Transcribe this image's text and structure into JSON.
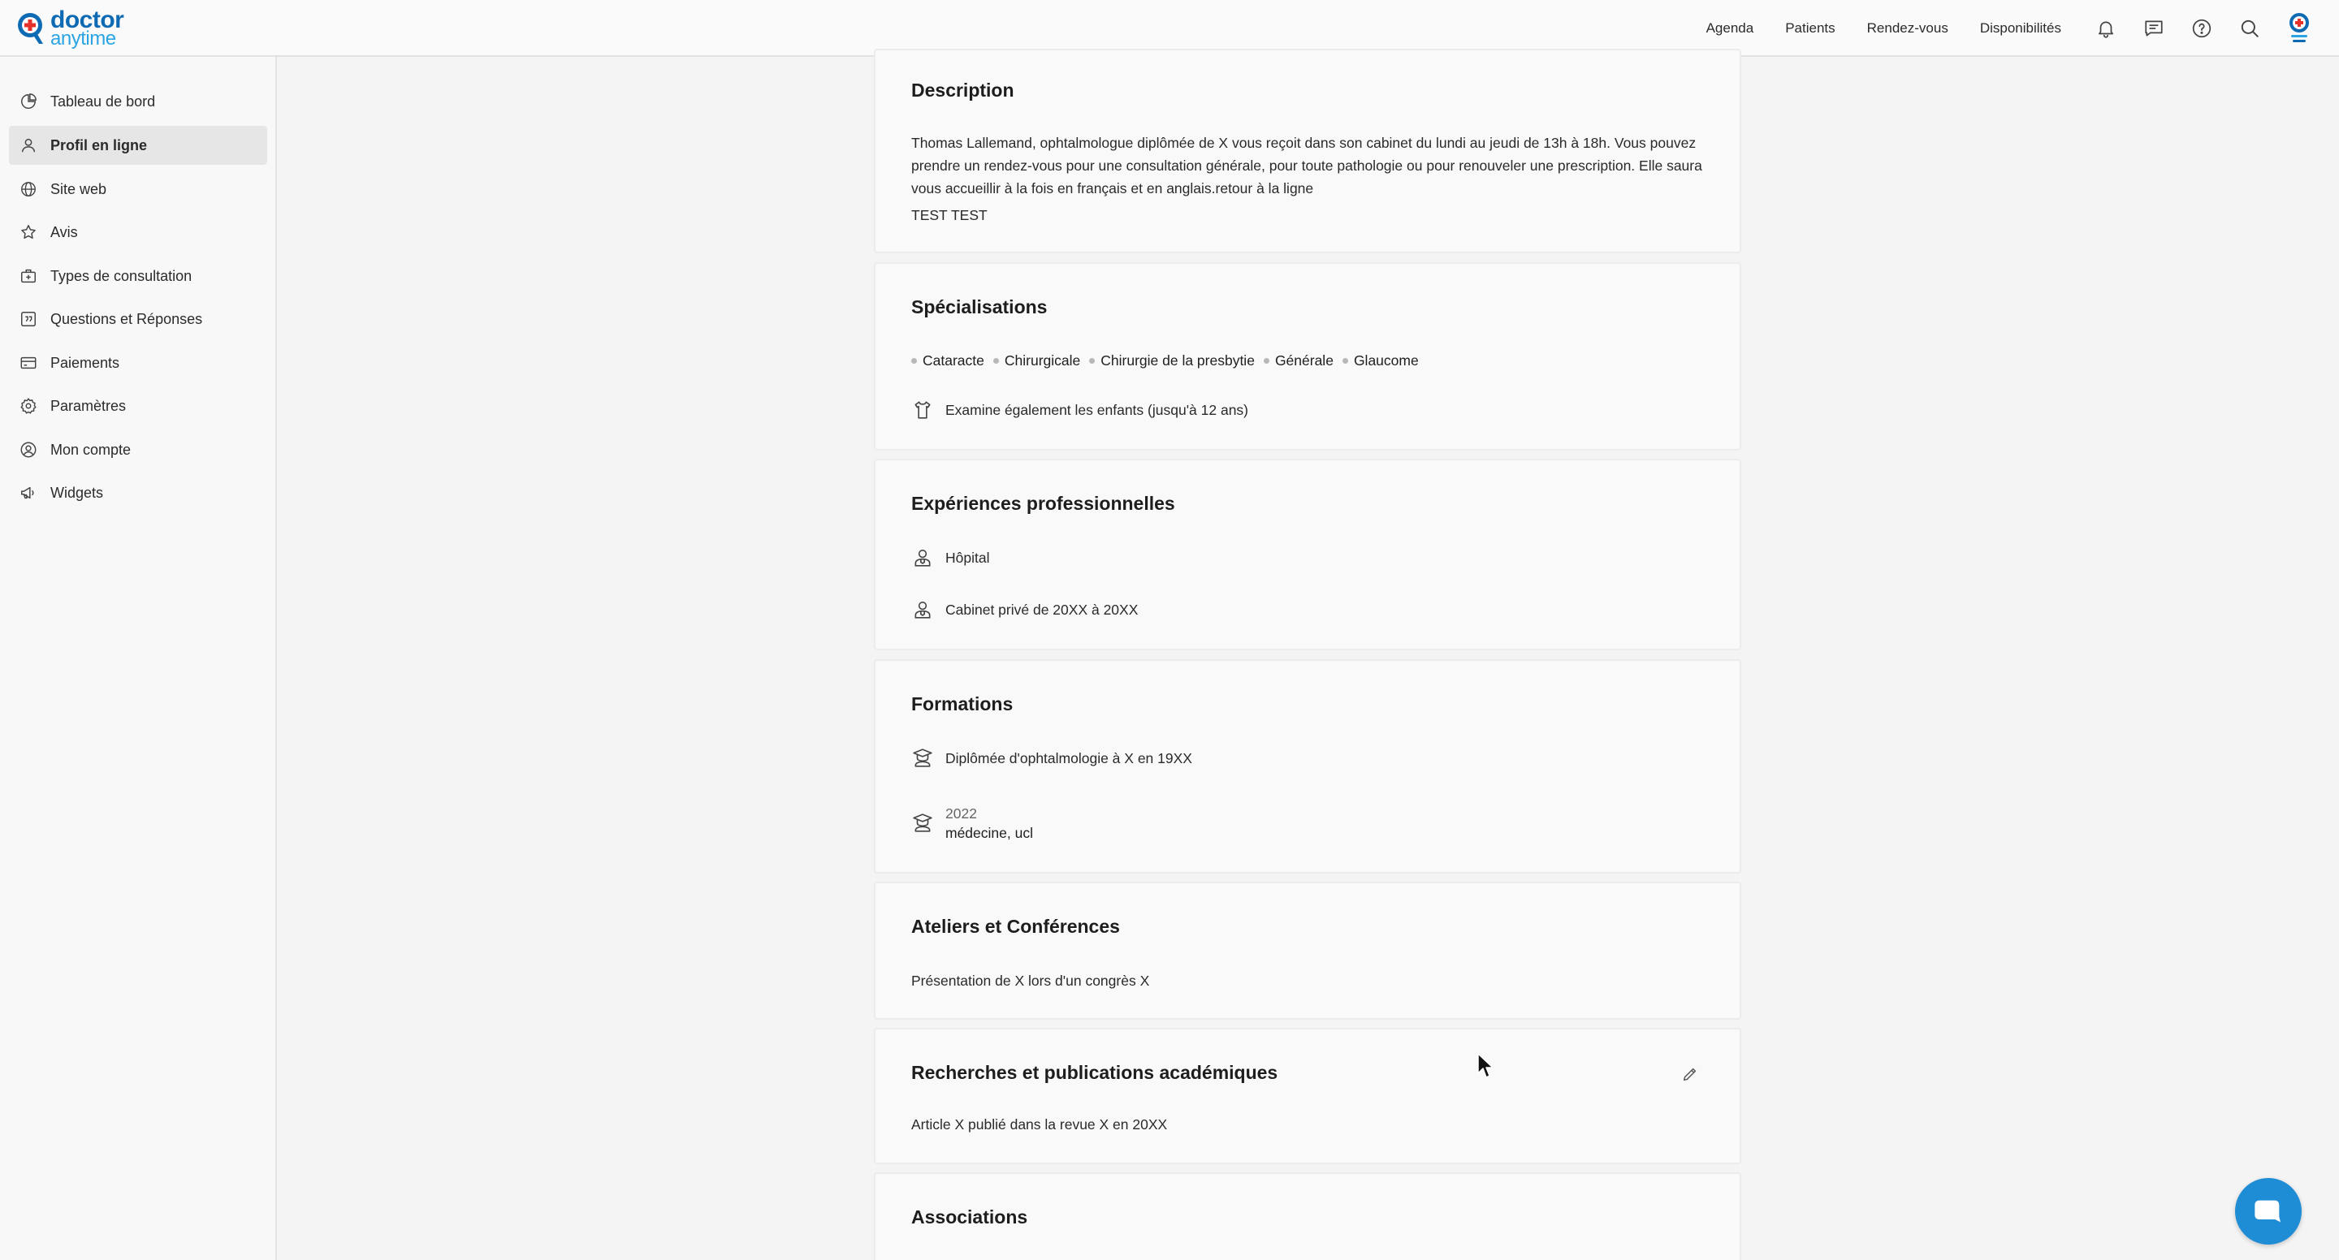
{
  "brand": {
    "line1": "doctor",
    "line2": "anytime",
    "primary": "#0f6ab4",
    "secondary": "#2aa4e3",
    "cross": "#e4322b"
  },
  "topnav": {
    "links": [
      "Agenda",
      "Patients",
      "Rendez-vous",
      "Disponibilités"
    ],
    "icons": [
      "bell-icon",
      "chat-icon",
      "help-icon",
      "search-icon",
      "user-avatar-icon"
    ]
  },
  "sidebar": {
    "items": [
      {
        "label": "Tableau de bord",
        "icon": "dashboard-icon"
      },
      {
        "label": "Profil en ligne",
        "icon": "user-icon",
        "active": true
      },
      {
        "label": "Site web",
        "icon": "globe-icon"
      },
      {
        "label": "Avis",
        "icon": "star-icon"
      },
      {
        "label": "Types de consultation",
        "icon": "medkit-icon"
      },
      {
        "label": "Questions et Réponses",
        "icon": "quote-icon"
      },
      {
        "label": "Paiements",
        "icon": "card-icon"
      },
      {
        "label": "Paramètres",
        "icon": "gear-icon"
      },
      {
        "label": "Mon compte",
        "icon": "account-icon"
      },
      {
        "label": "Widgets",
        "icon": "megaphone-icon"
      }
    ]
  },
  "description": {
    "title": "Description",
    "text": "Thomas Lallemand, ophtalmologue diplômée de X vous reçoit dans son cabinet du lundi au jeudi de 13h à 18h. Vous pouvez prendre un rendez-vous pour une consultation générale, pour toute pathologie ou pour renouveler une prescription. Elle saura vous accueillir à la fois en français et en anglais.retour à la ligne",
    "extra": "TEST TEST"
  },
  "specialisations": {
    "title": "Spécialisations",
    "items": [
      "Cataracte",
      "Chirurgicale",
      "Chirurgie de la presbytie",
      "Générale",
      "Glaucome"
    ],
    "children_note": "Examine également les enfants (jusqu'à 12 ans)"
  },
  "experiences": {
    "title": "Expériences professionnelles",
    "items": [
      "Hôpital",
      "Cabinet privé de 20XX à 20XX"
    ]
  },
  "formations": {
    "title": "Formations",
    "item1": "Diplômée d'ophtalmologie à X en 19XX",
    "item2_year": "2022",
    "item2_degree": "médecine, ucl"
  },
  "ateliers": {
    "title": "Ateliers et Conférences",
    "text": "Présentation de X lors d'un congrès X"
  },
  "recherches": {
    "title": "Recherches et publications académiques",
    "text": "Article X publié dans la revue X en 20XX"
  },
  "associations": {
    "title": "Associations"
  },
  "colors": {
    "accent": "#1f8dd6",
    "active_bg": "#e6e6e6"
  }
}
